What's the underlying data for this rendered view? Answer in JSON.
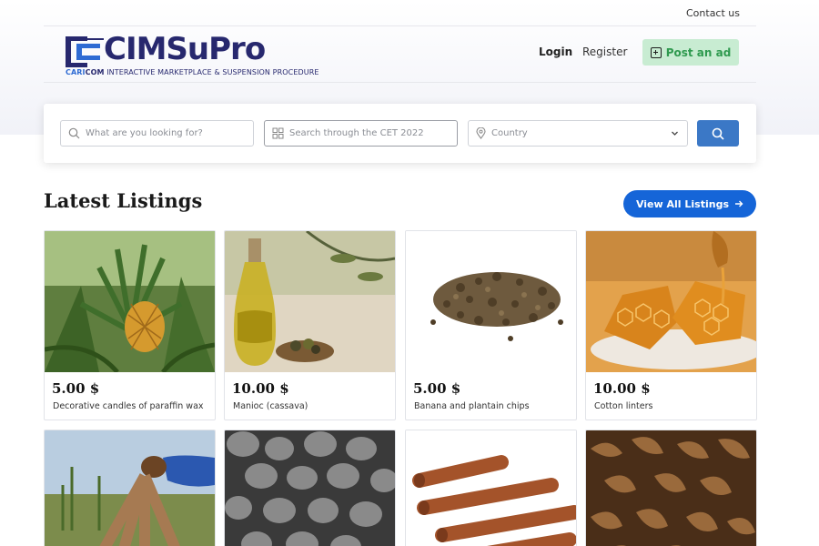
{
  "topbar": {
    "contact": "Contact us"
  },
  "logo": {
    "title": "CIMSuPro",
    "sub_cari": "CARI",
    "sub_com": "COM",
    "sub_rest": " INTERACTIVE MARKETPLACE & SUSPENSION PROCEDURE"
  },
  "nav": {
    "login": "Login",
    "register": "Register",
    "post_ad": "Post an ad"
  },
  "search": {
    "keyword_placeholder": "What are you looking for?",
    "cet_placeholder": "Search through the CET 2022",
    "country_placeholder": "Country"
  },
  "listings": {
    "title": "Latest Listings",
    "view_all": "View All Listings",
    "items": [
      {
        "price": "5.00 $",
        "name": "Decorative candles of paraffin wax",
        "image": "pineapple-plant"
      },
      {
        "price": "10.00 $",
        "name": "Manioc (cassava)",
        "image": "olive-oil-bottle"
      },
      {
        "price": "5.00 $",
        "name": "Banana and plantain chips",
        "image": "dried-seeds"
      },
      {
        "price": "10.00 $",
        "name": "Cotton linters",
        "image": "honeycomb"
      },
      {
        "image": "cassava-roots"
      },
      {
        "image": "gray-pebbles"
      },
      {
        "image": "cinnamon-sticks"
      },
      {
        "image": "nut-shells"
      }
    ]
  },
  "colors": {
    "brand_navy": "#27286e",
    "primary_blue": "#1565d8",
    "search_button": "#3b78c6",
    "post_ad_bg": "#c8ecd2",
    "post_ad_text": "#2f9a4f"
  }
}
